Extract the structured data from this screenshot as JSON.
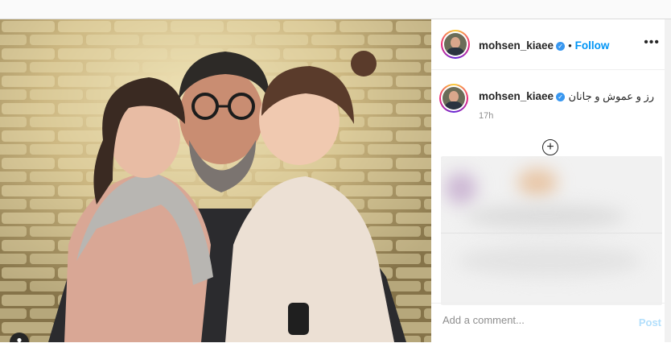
{
  "post": {
    "username": "mohsen_kiaee",
    "verified_icon": "verified-badge-icon",
    "separator": "•",
    "follow_label": "Follow",
    "more_icon": "more-options-icon",
    "caption": "رز و عموش و جانان",
    "time_ago": "17h",
    "add_icon": "add-circle-icon"
  },
  "comment": {
    "placeholder": "Add a comment...",
    "post_label": "Post"
  },
  "colors": {
    "link": "#0095f6",
    "post_disabled": "#b2dffc",
    "verified": "#3897f0",
    "text": "#262626",
    "muted": "#8e8e8e"
  }
}
